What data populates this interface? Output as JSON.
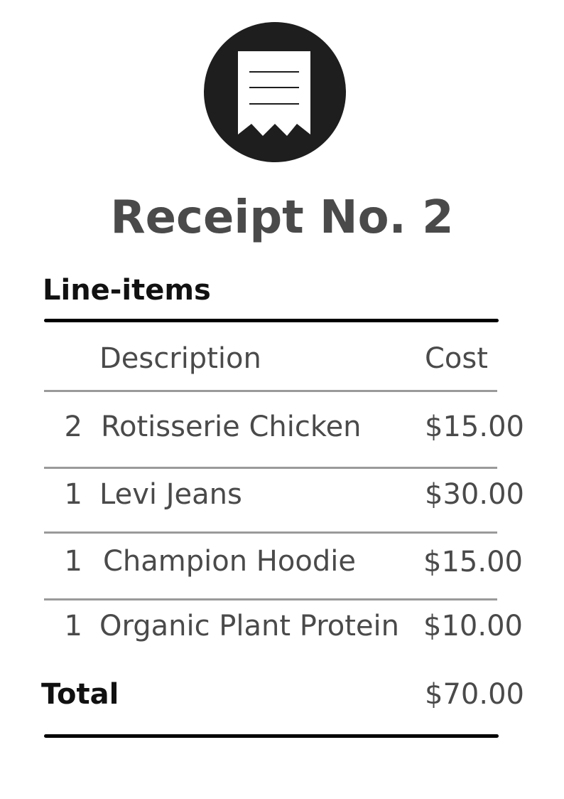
{
  "receipt": {
    "title": "Receipt No. 2",
    "section_title": "Line-items",
    "headers": {
      "description": "Description",
      "cost": "Cost"
    },
    "items": [
      {
        "qty": "2",
        "description": "Rotisserie Chicken",
        "cost": "$15.00"
      },
      {
        "qty": "1",
        "description": "Levi Jeans",
        "cost": "$30.00"
      },
      {
        "qty": "1",
        "description": "Champion Hoodie",
        "cost": "$15.00"
      },
      {
        "qty": "1",
        "description": "Organic Plant Protein",
        "cost": "$10.00"
      }
    ],
    "total_label": "Total",
    "total_value": "$70.00"
  },
  "icons": {
    "logo": "receipt-icon"
  },
  "colors": {
    "logo_circle": "#1e1e1e",
    "text": "#4a4a4a",
    "heading_text": "#111111",
    "rule_thin": "#9a9a9a",
    "rule_thick": "#000000"
  }
}
